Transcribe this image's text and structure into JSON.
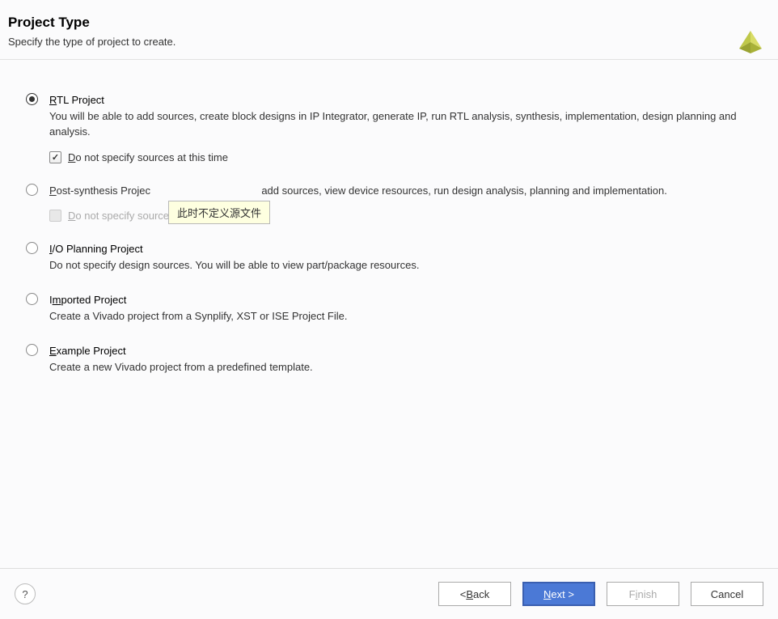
{
  "header": {
    "title": "Project Type",
    "subtitle": "Specify the type of project to create."
  },
  "options": {
    "rtl": {
      "title_underline": "R",
      "title_rest": "TL Project",
      "desc": "You will be able to add sources, create block designs in IP Integrator, generate IP, run RTL analysis, synthesis, implementation, design planning and analysis.",
      "checkbox_underline": "D",
      "checkbox_rest": "o not specify sources at this time"
    },
    "post": {
      "title_underline": "P",
      "title_rest": "ost-synthesis Projec",
      "desc_rest": "add sources, view device resources, run design analysis, planning and implementation.",
      "checkbox_underline": "D",
      "checkbox_rest": "o not specify sources at this time"
    },
    "io": {
      "title_underline": "I",
      "title_rest": "/O Planning Project",
      "desc": "Do not specify design sources. You will be able to view part/package resources."
    },
    "imported": {
      "title_pre": "I",
      "title_underline": "m",
      "title_rest": "ported Project",
      "desc": "Create a Vivado project from a Synplify, XST or ISE Project File."
    },
    "example": {
      "title_underline": "E",
      "title_rest": "xample Project",
      "desc": "Create a new Vivado project from a predefined template."
    }
  },
  "tooltip": "此时不定义源文件",
  "buttons": {
    "help": "?",
    "back_lt": "< ",
    "back_underline": "B",
    "back_rest": "ack",
    "next_underline": "N",
    "next_rest": "ext >",
    "finish_pre": "F",
    "finish_underline": "i",
    "finish_rest": "nish",
    "cancel": "Cancel"
  }
}
